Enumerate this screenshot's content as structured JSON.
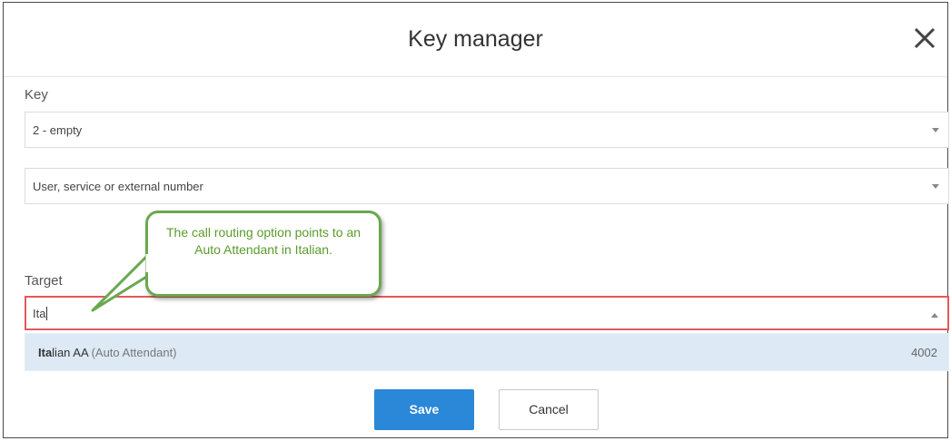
{
  "dialog": {
    "title": "Key manager",
    "close_icon": "close-icon"
  },
  "key": {
    "label": "Key",
    "value": "2 - empty"
  },
  "destination": {
    "value": "User, service or external number"
  },
  "target": {
    "label": "Target",
    "input_value": "Ita"
  },
  "suggestion": {
    "match": "Ita",
    "rest": "lian AA",
    "type": "(Auto Attendant)",
    "extension": "4002"
  },
  "callout": {
    "text": "The call routing option points to an Auto Attendant in Italian."
  },
  "buttons": {
    "save": "Save",
    "cancel": "Cancel"
  },
  "colors": {
    "save_button": "#2b87d8",
    "target_border": "#e05a5a",
    "suggestion_bg": "#dde9f5",
    "callout_border": "#6aa84f",
    "callout_text": "#5b9b2b"
  }
}
